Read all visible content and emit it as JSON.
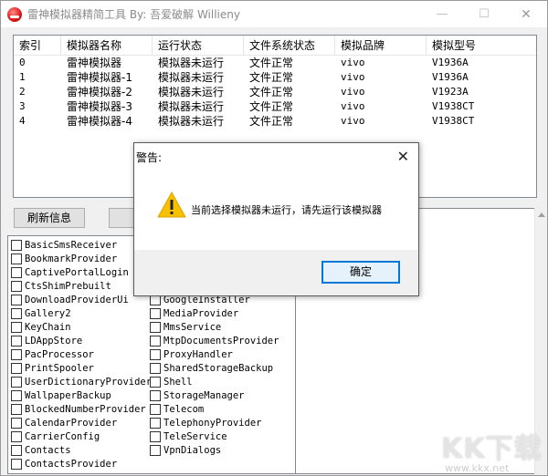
{
  "window": {
    "title": "雷神模拟器精简工具 By: 吾爱破解 Willieny",
    "minimize_glyph": "—",
    "maximize_glyph": "☐",
    "close_glyph": "✕"
  },
  "table": {
    "columns": [
      "索引",
      "模拟器名称",
      "运行状态",
      "文件系统状态",
      "模拟品牌",
      "模拟型号"
    ],
    "rows": [
      [
        "0",
        "雷神模拟器",
        "模拟器未运行",
        "文件正常",
        "vivo",
        "V1936A"
      ],
      [
        "1",
        "雷神模拟器-1",
        "模拟器未运行",
        "文件正常",
        "vivo",
        "V1936A"
      ],
      [
        "2",
        "雷神模拟器-2",
        "模拟器未运行",
        "文件正常",
        "vivo",
        "V1923A"
      ],
      [
        "3",
        "雷神模拟器-3",
        "模拟器未运行",
        "文件正常",
        "vivo",
        "V1938CT"
      ],
      [
        "4",
        "雷神模拟器-4",
        "模拟器未运行",
        "文件正常",
        "vivo",
        "V1938CT"
      ]
    ]
  },
  "buttons": {
    "refresh_label": "刷新信息",
    "second_label": ""
  },
  "packages": {
    "left_column": [
      "BasicSmsReceiver",
      "BookmarkProvider",
      "CaptivePortalLogin",
      "CtsShimPrebuilt",
      "DownloadProviderUi",
      "Gallery2",
      "KeyChain",
      "LDAppStore",
      "PacProcessor",
      "PrintSpooler",
      "UserDictionaryProvider",
      "WallpaperBackup",
      "BlockedNumberProvider",
      "CalendarProvider",
      "CarrierConfig",
      "Contacts",
      "ContactsProvider"
    ],
    "right_column": [
      "GoogleInstaller",
      "MediaProvider",
      "MmsService",
      "MtpDocumentsProvider",
      "ProxyHandler",
      "SharedStorageBackup",
      "Shell",
      "StorageManager",
      "Telecom",
      "TelephonyProvider",
      "TeleService",
      "VpnDialogs"
    ]
  },
  "dialog": {
    "title": "警告:",
    "message": "当前选择模拟器未运行，请先运行该模拟器",
    "ok_label": "确定",
    "icon": "warning-icon",
    "close_glyph": "✕"
  },
  "watermark": {
    "text": "KK下载",
    "url": "www.kkx.net"
  },
  "colors": {
    "accent": "#0078d7",
    "warning": "#f7c100"
  }
}
